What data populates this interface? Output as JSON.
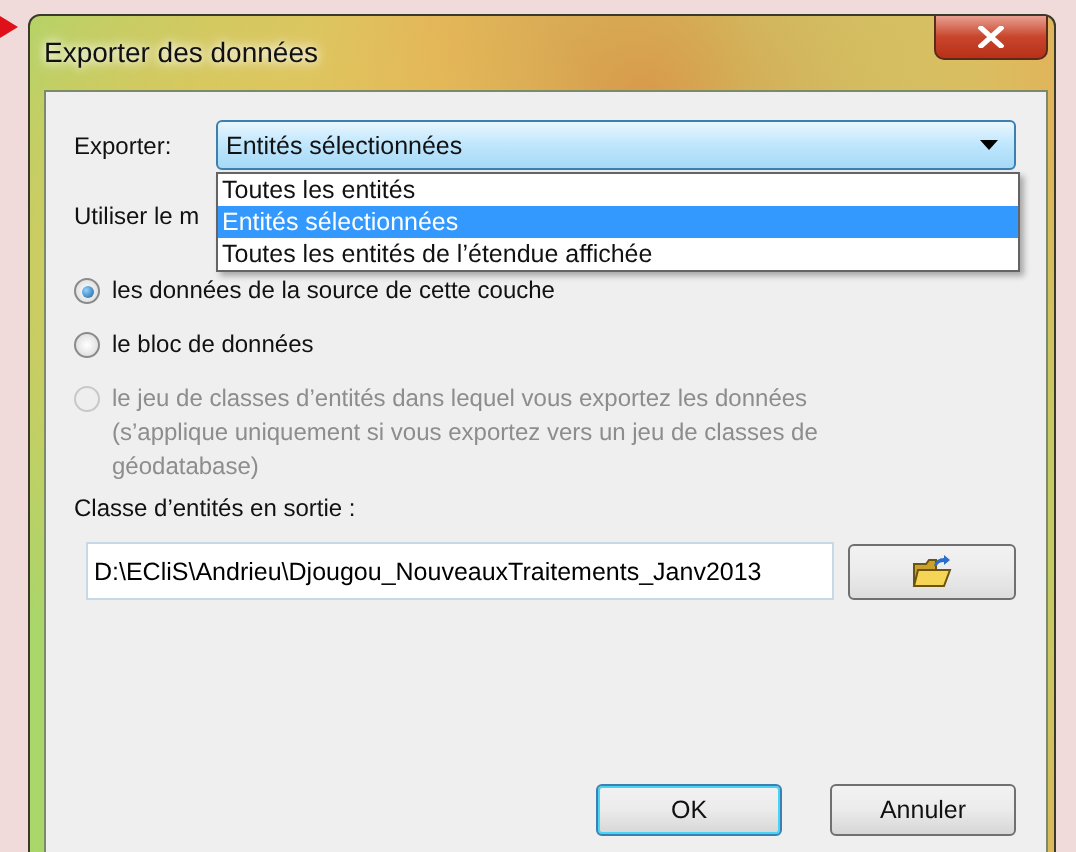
{
  "window": {
    "title": "Exporter des données"
  },
  "export": {
    "label": "Exporter:",
    "value": "Entités sélectionnées",
    "expanded": true,
    "options": [
      {
        "label": "Toutes les entités",
        "selected": false
      },
      {
        "label": "Entités sélectionnées",
        "selected": true
      },
      {
        "label": "Toutes les entités de l’étendue affichée",
        "selected": false
      }
    ]
  },
  "use_label": "Utiliser le m",
  "radios": [
    {
      "label": "les données de la source de cette couche",
      "selected": true,
      "disabled": false
    },
    {
      "label": "le bloc de données",
      "selected": false,
      "disabled": false
    },
    {
      "label": "le jeu de classes d’entités dans lequel vous exportez les données (s’applique uniquement si vous exportez vers un jeu de classes de géodatabase)",
      "selected": false,
      "disabled": true
    }
  ],
  "output": {
    "label": "Classe d’entités en sortie :",
    "value": "D:\\ECliS\\Andrieu\\Djougou_NouveauxTraitements_Janv2013"
  },
  "buttons": [
    {
      "label": "OK",
      "default": true
    },
    {
      "label": "Annuler",
      "default": false
    }
  ]
}
